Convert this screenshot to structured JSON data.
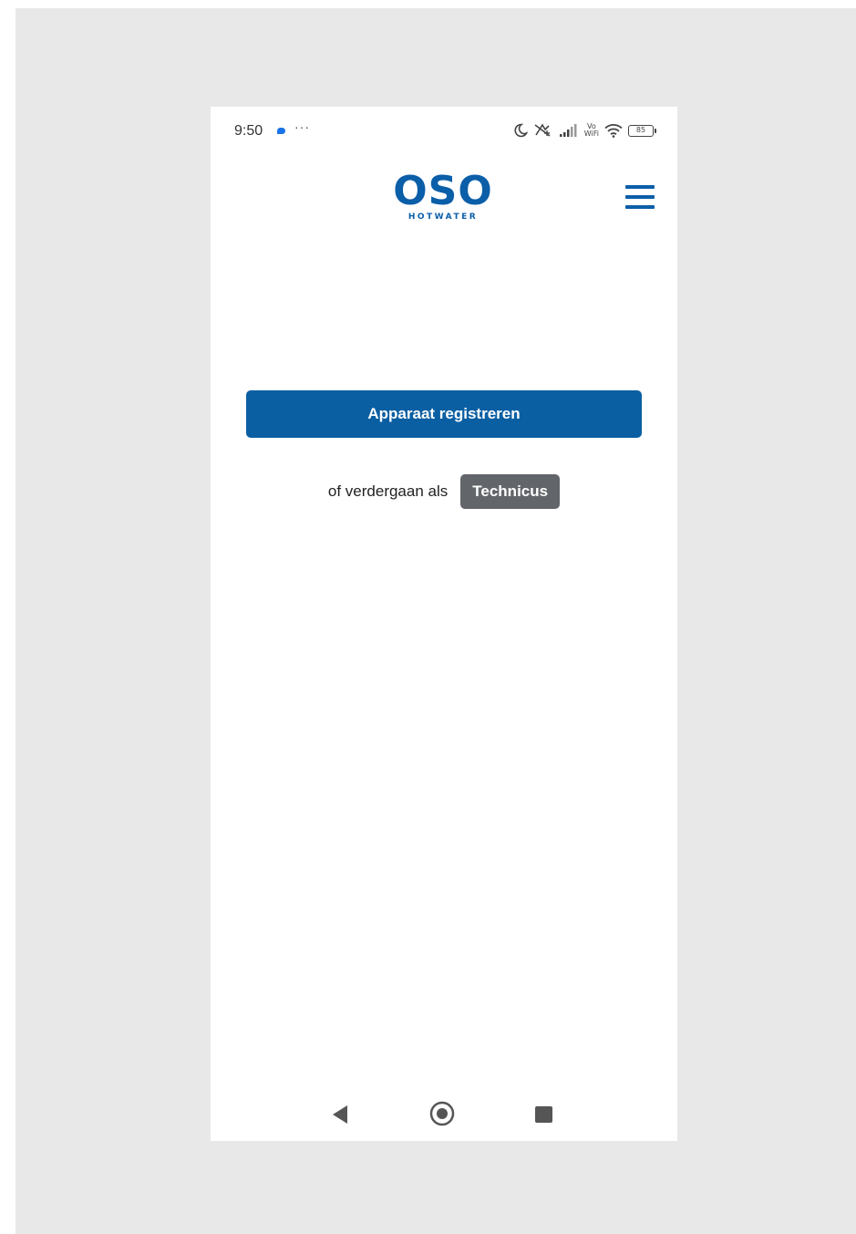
{
  "status_bar": {
    "time": "9:50",
    "more": "···",
    "vowifi_top": "Vo",
    "vowifi_bottom": "WiFi",
    "battery": "85",
    "icons": [
      "message-icon",
      "moon-icon",
      "data-off-icon",
      "signal-icon",
      "vowifi-icon",
      "wifi-icon",
      "battery-icon"
    ]
  },
  "header": {
    "logo_main": "OSO",
    "logo_sub": "HOTWATER",
    "menu_icon": "hamburger-menu-icon"
  },
  "main": {
    "register_label": "Apparaat registreren",
    "alt_text": "of verdergaan als",
    "technicus_label": "Technicus"
  },
  "nav_bar": {
    "icons": [
      "back-icon",
      "home-icon",
      "recents-icon"
    ]
  },
  "colors": {
    "brand": "#0b5ea8",
    "primary_button": "#0a5fa3",
    "secondary_button": "#62666b",
    "backdrop": "#e8e8e8"
  }
}
